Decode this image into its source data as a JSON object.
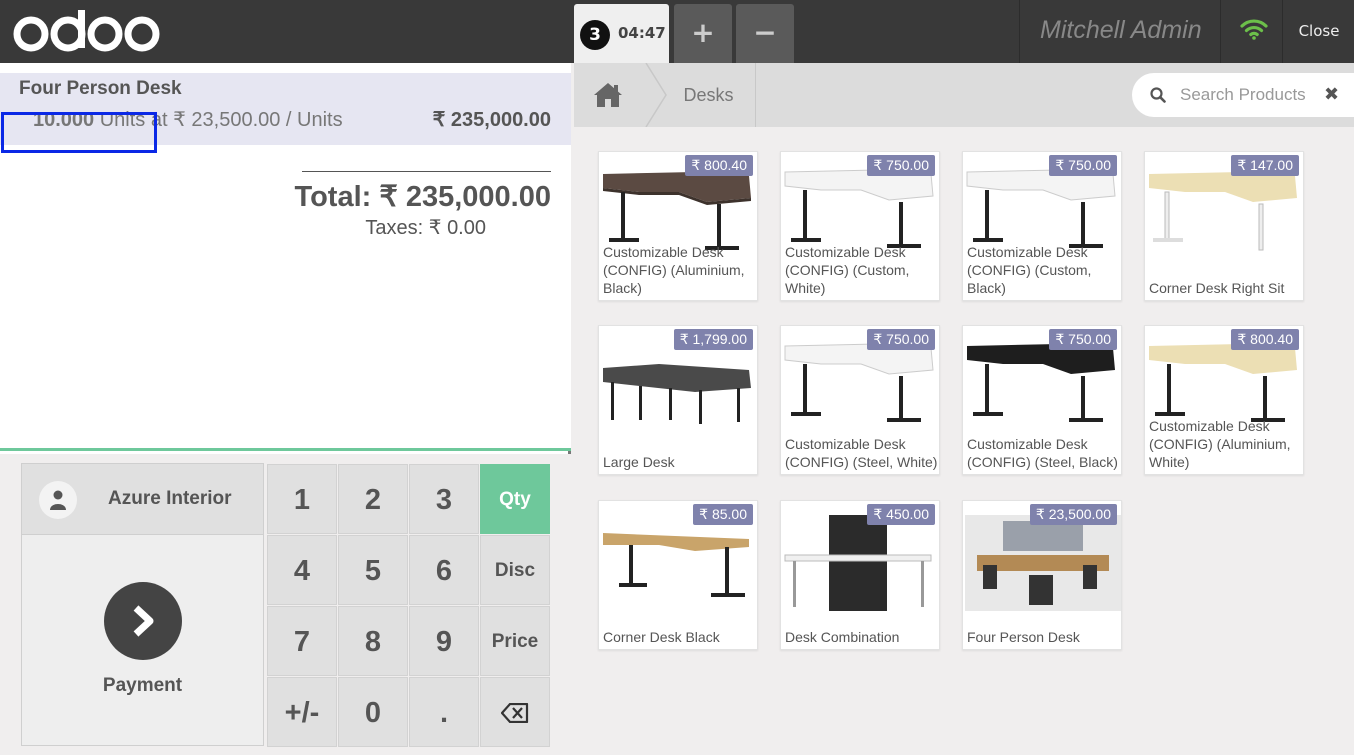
{
  "header": {
    "logo_text": "odoo",
    "order_number": "3",
    "order_time": "04:47",
    "add_order_label": "+",
    "remove_order_label": "−",
    "user_name": "Mitchell Admin",
    "close_label": "Close"
  },
  "orderline": {
    "product_name": "Four Person Desk",
    "quantity": "10.000",
    "unit": "Units",
    "price_info": "at ₹ 23,500.00 / Units",
    "line_total": "₹ 235,000.00"
  },
  "summary": {
    "total": "Total: ₹ 235,000.00",
    "taxes": "Taxes: ₹ 0.00"
  },
  "customer": {
    "name": "Azure Interior"
  },
  "payment": {
    "label": "Payment"
  },
  "numpad": {
    "keys": [
      "1",
      "2",
      "3",
      "Qty",
      "4",
      "5",
      "6",
      "Disc",
      "7",
      "8",
      "9",
      "Price",
      "+/-",
      "0",
      "."
    ],
    "selected_mode": "Qty"
  },
  "breadcrumb": {
    "category": "Desks"
  },
  "search": {
    "placeholder": "Search Products"
  },
  "products": [
    {
      "name": "Customizable Desk (CONFIG) (Aluminium, Black)",
      "price": "₹ 800.40"
    },
    {
      "name": "Customizable Desk (CONFIG) (Custom, White)",
      "price": "₹ 750.00"
    },
    {
      "name": "Customizable Desk (CONFIG) (Custom, Black)",
      "price": "₹ 750.00"
    },
    {
      "name": "Corner Desk Right Sit",
      "price": "₹ 147.00"
    },
    {
      "name": "Large Desk",
      "price": "₹ 1,799.00"
    },
    {
      "name": "Customizable Desk (CONFIG) (Steel, White)",
      "price": "₹ 750.00"
    },
    {
      "name": "Customizable Desk (CONFIG) (Steel, Black)",
      "price": "₹ 750.00"
    },
    {
      "name": "Customizable Desk (CONFIG) (Aluminium, White)",
      "price": "₹ 800.40"
    },
    {
      "name": "Corner Desk Black",
      "price": "₹ 85.00"
    },
    {
      "name": "Desk Combination",
      "price": "₹ 450.00"
    },
    {
      "name": "Four Person Desk",
      "price": "₹ 23,500.00"
    }
  ],
  "colors": {
    "header_bg": "#393939",
    "accent_green": "#6ec89b",
    "price_tag": "#7f82ac",
    "selected_line": "#e6e6f2",
    "highlight": "#0a28e6"
  }
}
